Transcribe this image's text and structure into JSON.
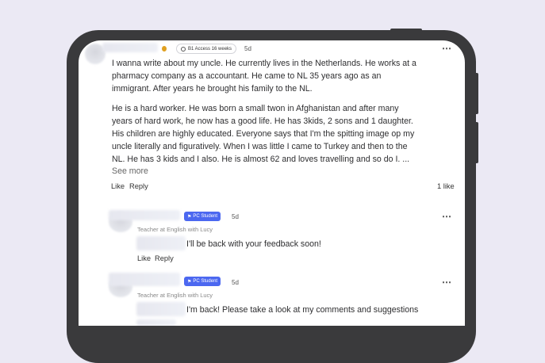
{
  "post": {
    "level_badge": "B1 Access 16 weeks",
    "time": "5d",
    "more_icon": "⋯",
    "paragraph_1_lines": [
      "I wanna write about my uncle. He currently lives in the Netherlands. He works at a",
      "pharmacy company as a accountant. He came to NL 35 years ago as an",
      "immigrant. After years he brought his family to the NL."
    ],
    "paragraph_2_lines": [
      "He is a hard worker. He was born a small twon in Afghanistan and after many",
      "years of hard work, he now has a good life. He has 3kids, 2 sons and 1 daughter.",
      "His children are highly educated. Everyone says that I'm the spitting image op my",
      "uncle literally and figuratively. When I was little I came to Turkey and then to the",
      "NL. He has 3 kids and I also. He is almost 62 and loves travelling and so do I. ..."
    ],
    "see_more": "See more",
    "like": "Like",
    "reply": "Reply",
    "like_count": "1 like"
  },
  "comments": [
    {
      "badge": "PC Student",
      "time": "5d",
      "subtitle": "Teacher at English with Lucy",
      "text": "I'll be back with your feedback soon!",
      "like": "Like",
      "reply": "Reply"
    },
    {
      "badge": "PC Student",
      "time": "5d",
      "subtitle": "Teacher at English with Lucy",
      "text": "I'm back! Please take a look at my comments and suggestions"
    }
  ],
  "colors": {
    "badge_blue": "#4c68f0",
    "background": "#ebe9f4",
    "phone_frame": "#3a3a3c"
  }
}
